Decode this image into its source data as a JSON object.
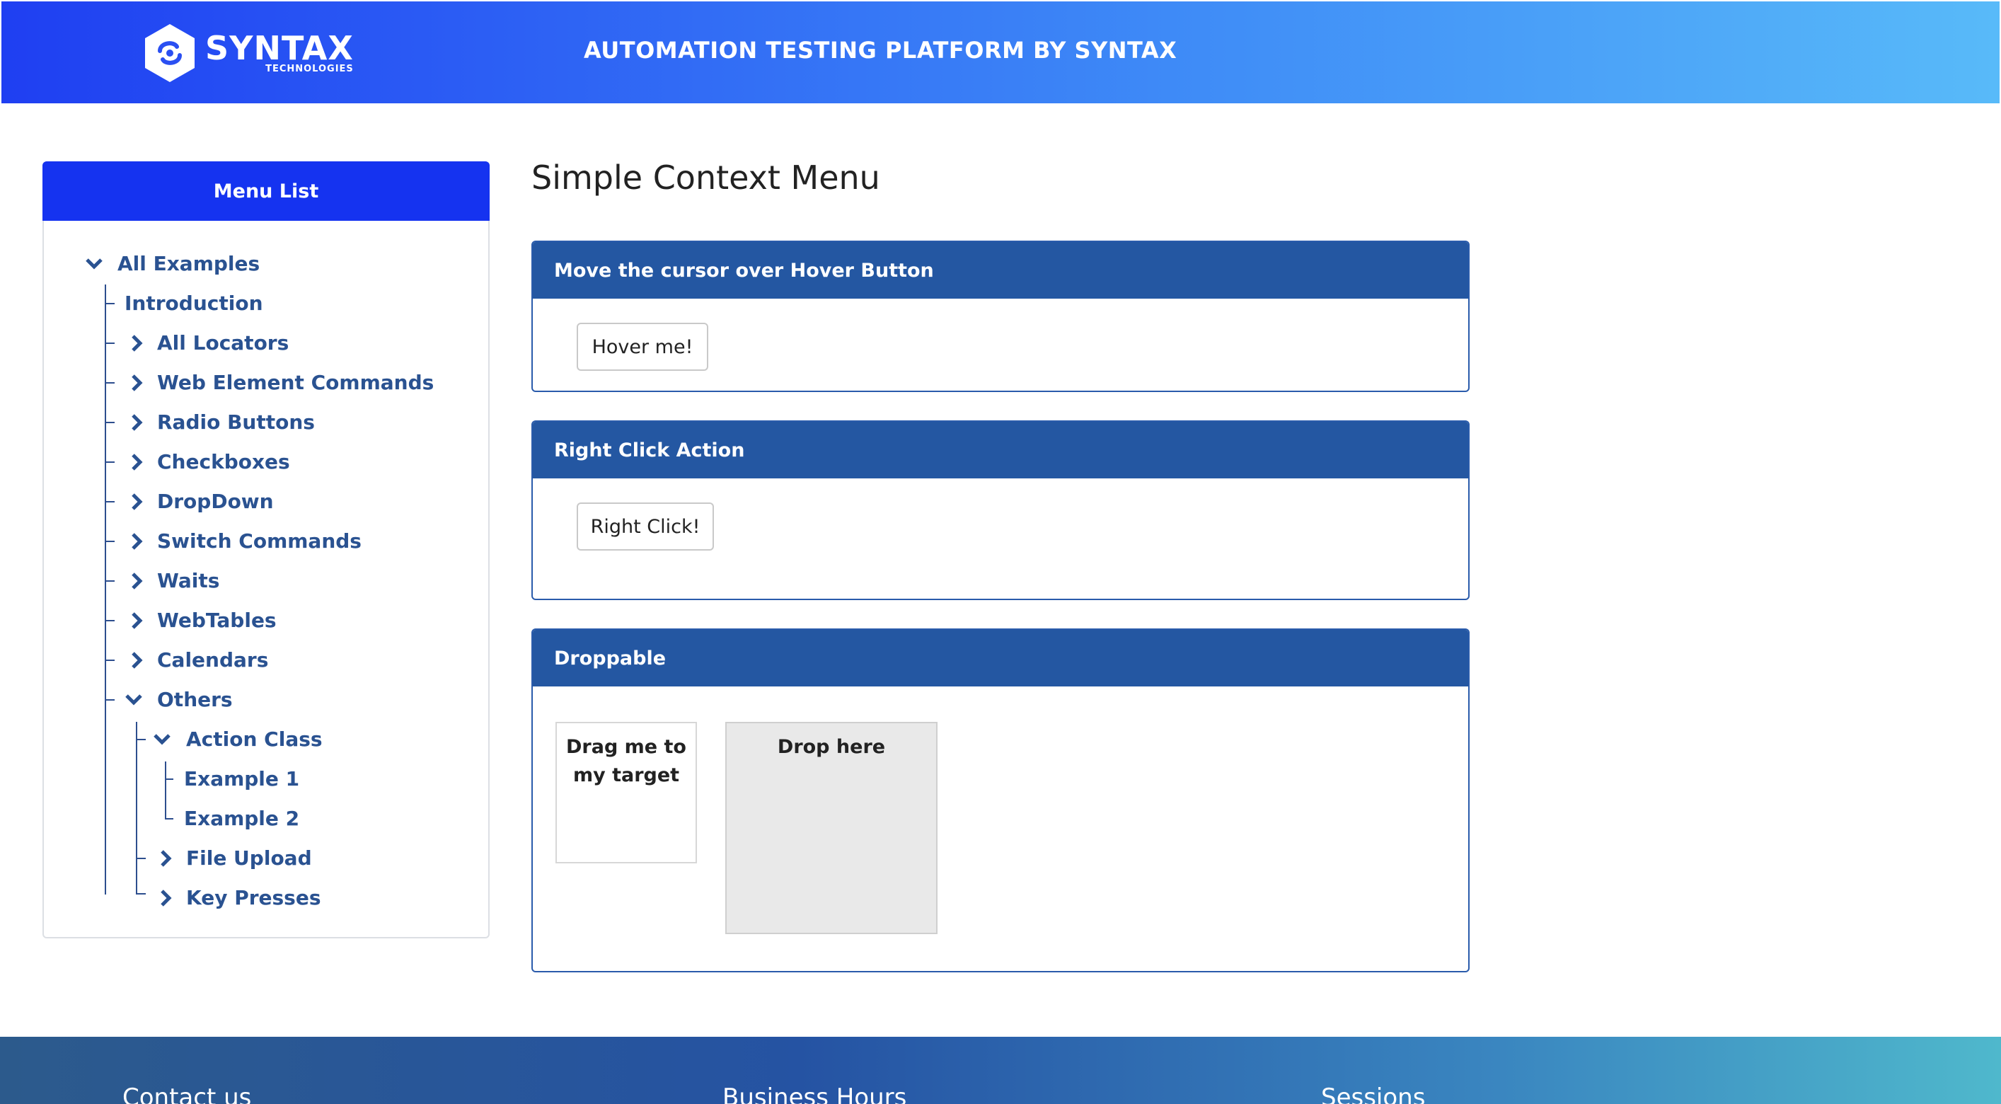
{
  "header": {
    "logo_word": "SYNTAX",
    "logo_sub": "TECHNOLOGIES",
    "title": "AUTOMATION TESTING PLATFORM BY SYNTAX"
  },
  "menu": {
    "title": "Menu List",
    "items": [
      {
        "label": "All Examples",
        "icon": "chevron-down-icon"
      },
      {
        "label": "Introduction",
        "icon": ""
      },
      {
        "label": "All Locators",
        "icon": "chevron-right-icon"
      },
      {
        "label": "Web Element Commands",
        "icon": "chevron-right-icon"
      },
      {
        "label": "Radio Buttons",
        "icon": "chevron-right-icon"
      },
      {
        "label": "Checkboxes",
        "icon": "chevron-right-icon"
      },
      {
        "label": "DropDown",
        "icon": "chevron-right-icon"
      },
      {
        "label": "Switch Commands",
        "icon": "chevron-right-icon"
      },
      {
        "label": "Waits",
        "icon": "chevron-right-icon"
      },
      {
        "label": "WebTables",
        "icon": "chevron-right-icon"
      },
      {
        "label": "Calendars",
        "icon": "chevron-right-icon"
      },
      {
        "label": "Others",
        "icon": "chevron-down-icon"
      },
      {
        "label": "Action Class",
        "icon": "chevron-down-icon"
      },
      {
        "label": "Example 1",
        "icon": ""
      },
      {
        "label": "Example 2",
        "icon": ""
      },
      {
        "label": "File Upload",
        "icon": "chevron-right-icon"
      },
      {
        "label": "Key Presses",
        "icon": "chevron-right-icon"
      }
    ]
  },
  "main": {
    "title": "Simple Context Menu",
    "hover_card": {
      "heading": "Move the cursor over Hover Button",
      "button": "Hover me!"
    },
    "right_click_card": {
      "heading": "Right Click Action",
      "button": "Right Click!"
    },
    "droppable_card": {
      "heading": "Droppable",
      "draggable": "Drag me to my target",
      "target": "Drop here"
    }
  },
  "footer": {
    "columns": [
      "Contact us",
      "Business Hours",
      "Sessions"
    ]
  },
  "colors": {
    "header_start": "#1f3ff2",
    "header_end": "#58baf9",
    "menu_head": "#1533f0",
    "card_head": "#2457a2",
    "tree_text": "#2a5291"
  }
}
